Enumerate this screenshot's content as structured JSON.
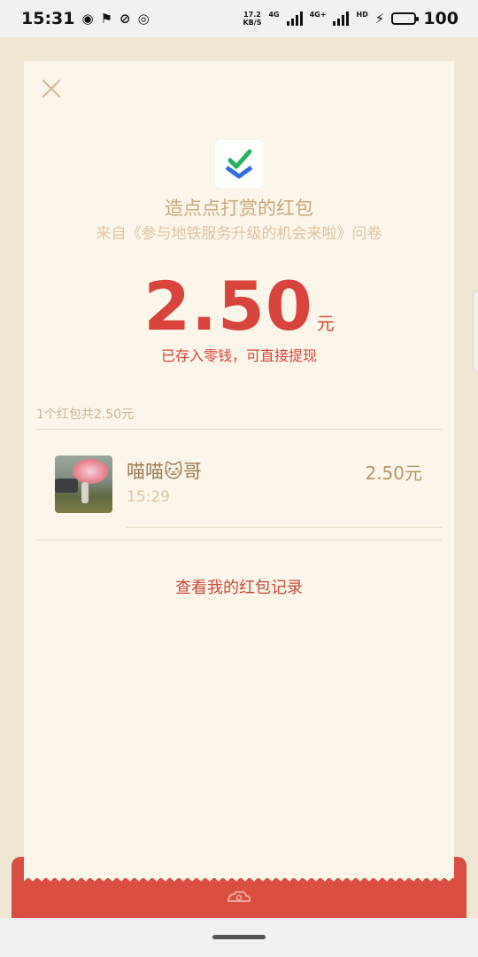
{
  "status_bar": {
    "time": "15:31",
    "net_speed_top": "17.2",
    "net_speed_bottom": "KB/S",
    "net_type_1": "4G",
    "net_type_2": "4G+",
    "hd_label": "HD",
    "battery": "100"
  },
  "packet": {
    "title": "造点点打赏的红包",
    "subtitle": "来自《参与地铁服务升级的机会来啦》问卷",
    "amount": "2.50",
    "amount_unit": "元",
    "deposit_note": "已存入零钱，可直接提现",
    "count_summary": "1个红包共2.50元"
  },
  "sender": {
    "name": "喵喵🐱哥",
    "time": "15:29",
    "amount": "2.50元"
  },
  "links": {
    "records": "查看我的红包记录"
  },
  "colors": {
    "accent_red": "#d8443b",
    "envelope_red": "#d94e41",
    "card_bg": "#fbf6e9",
    "gold_text": "#c9a77a"
  },
  "icons": {
    "close": "close-icon",
    "logo": "checkmark-logo-icon",
    "envelope": "cloud-ornament-icon"
  }
}
